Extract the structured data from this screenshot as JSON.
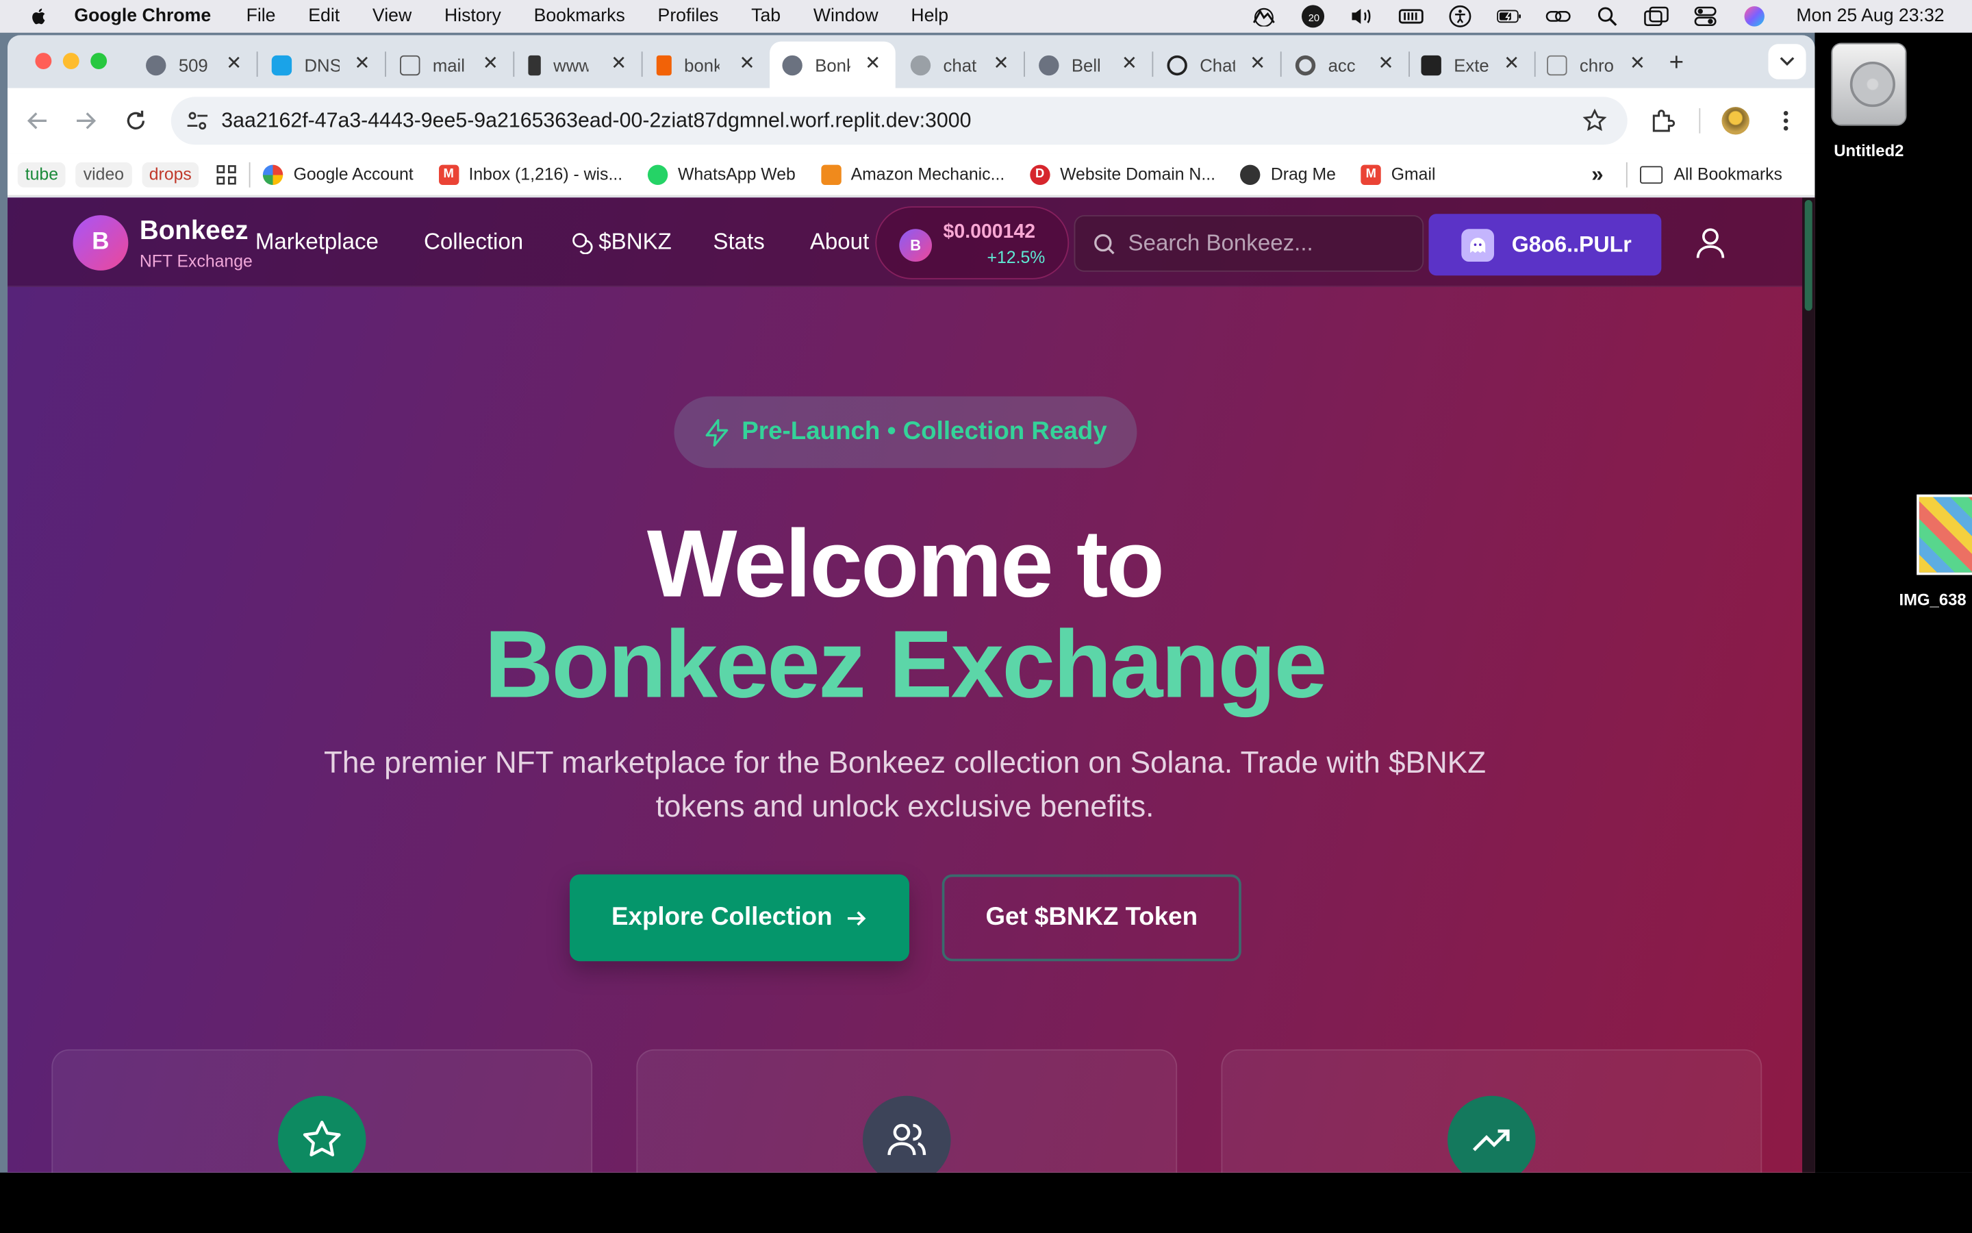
{
  "menubar": {
    "app_name": "Google Chrome",
    "items": [
      "File",
      "Edit",
      "View",
      "History",
      "Bookmarks",
      "Profiles",
      "Tab",
      "Window",
      "Help"
    ],
    "badge_count": "20",
    "clock": "Mon 25 Aug  23:32"
  },
  "desktop": {
    "hd_label": "Untitled2",
    "image_label": "IMG_638"
  },
  "browser": {
    "tabs": [
      {
        "title": "509",
        "icon": "globe-icon",
        "active": false
      },
      {
        "title": "DNS",
        "icon": "pin-icon",
        "active": false
      },
      {
        "title": "mail",
        "icon": "house-icon",
        "active": false
      },
      {
        "title": "www",
        "icon": "bookmark-icon",
        "active": false
      },
      {
        "title": "bonkeez",
        "icon": "replit-icon",
        "active": false
      },
      {
        "title": "Bonkeez",
        "icon": "globe-icon",
        "active": true
      },
      {
        "title": "chat",
        "icon": "globe-icon",
        "active": false
      },
      {
        "title": "Bell",
        "icon": "globe-icon",
        "active": false
      },
      {
        "title": "Chat",
        "icon": "openai-icon",
        "active": false
      },
      {
        "title": "acc",
        "icon": "google-icon",
        "active": false
      },
      {
        "title": "Extensions",
        "icon": "puzzle-icon",
        "active": false
      },
      {
        "title": "chrome",
        "icon": "image-icon",
        "active": false
      }
    ],
    "url": "3aa2162f-47a3-4443-9ee5-9a2165363ead-00-2ziat87dgmnel.worf.replit.dev:3000",
    "bookmark_chips": [
      "tube",
      "video",
      "drops"
    ],
    "bookmarks": [
      {
        "label": "Google Account",
        "icon": "google-icon"
      },
      {
        "label": "Inbox (1,216) - wis...",
        "icon": "gmail-icon"
      },
      {
        "label": "WhatsApp Web",
        "icon": "whatsapp-icon"
      },
      {
        "label": "Amazon Mechanic...",
        "icon": "amazon-icon"
      },
      {
        "label": "Website Domain N...",
        "icon": "domain-icon"
      },
      {
        "label": "Drag Me",
        "icon": "globe-icon"
      },
      {
        "label": "Gmail",
        "icon": "gmail-icon"
      }
    ],
    "all_bookmarks": "All Bookmarks"
  },
  "site": {
    "logo_letter": "B",
    "brand_name": "Bonkeez",
    "brand_sub": "NFT Exchange",
    "nav": [
      "Marketplace",
      "Collection",
      "$BNKZ",
      "Stats",
      "About"
    ],
    "price": {
      "coin_letter": "B",
      "value": "$0.000142",
      "change": "+12.5%"
    },
    "search_placeholder": "Search Bonkeez...",
    "wallet_label": "G8o6..PULr",
    "hero": {
      "badge": "Pre-Launch • Collection Ready",
      "line1": "Welcome to",
      "line2": "Bonkeez Exchange",
      "description": "The premier NFT marketplace for the Bonkeez collection on Solana. Trade with $BNKZ tokens and unlock exclusive benefits.",
      "primary_cta": "Explore Collection",
      "secondary_cta": "Get $BNKZ Token"
    },
    "features": [
      {
        "icon": "star-icon",
        "color": "#0d8a61"
      },
      {
        "icon": "users-icon",
        "color": "#3d4459"
      },
      {
        "icon": "trending-up-icon",
        "color": "#14795d"
      }
    ]
  },
  "colors": {
    "accent_green": "#05966b",
    "headline_green": "#5cd6a8",
    "wallet_purple": "#5b33c7",
    "price_pink": "#f9a8d4",
    "change_teal": "#5eead4"
  }
}
